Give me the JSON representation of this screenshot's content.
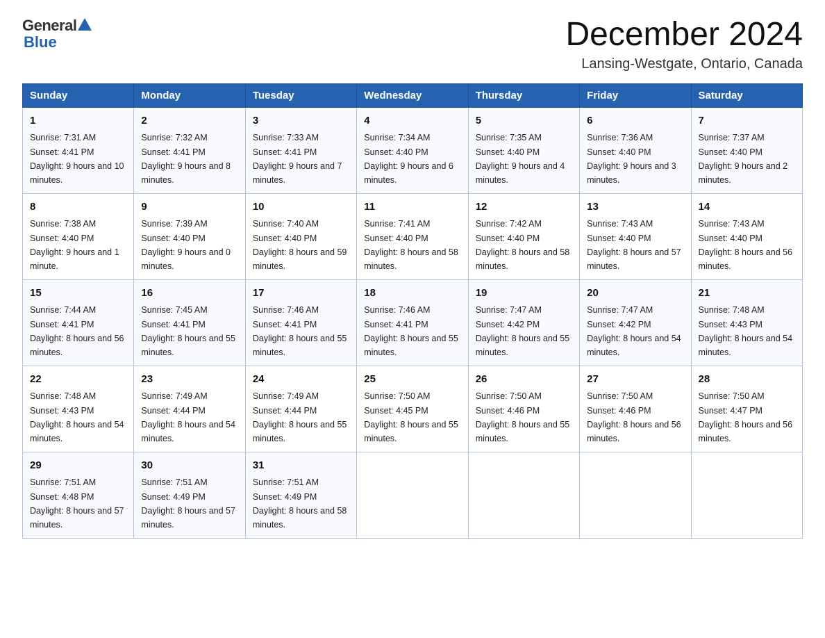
{
  "logo": {
    "general": "General",
    "blue": "Blue"
  },
  "header": {
    "title": "December 2024",
    "location": "Lansing-Westgate, Ontario, Canada"
  },
  "days_of_week": [
    "Sunday",
    "Monday",
    "Tuesday",
    "Wednesday",
    "Thursday",
    "Friday",
    "Saturday"
  ],
  "weeks": [
    [
      {
        "day": "1",
        "sunrise": "7:31 AM",
        "sunset": "4:41 PM",
        "daylight": "9 hours and 10 minutes."
      },
      {
        "day": "2",
        "sunrise": "7:32 AM",
        "sunset": "4:41 PM",
        "daylight": "9 hours and 8 minutes."
      },
      {
        "day": "3",
        "sunrise": "7:33 AM",
        "sunset": "4:41 PM",
        "daylight": "9 hours and 7 minutes."
      },
      {
        "day": "4",
        "sunrise": "7:34 AM",
        "sunset": "4:40 PM",
        "daylight": "9 hours and 6 minutes."
      },
      {
        "day": "5",
        "sunrise": "7:35 AM",
        "sunset": "4:40 PM",
        "daylight": "9 hours and 4 minutes."
      },
      {
        "day": "6",
        "sunrise": "7:36 AM",
        "sunset": "4:40 PM",
        "daylight": "9 hours and 3 minutes."
      },
      {
        "day": "7",
        "sunrise": "7:37 AM",
        "sunset": "4:40 PM",
        "daylight": "9 hours and 2 minutes."
      }
    ],
    [
      {
        "day": "8",
        "sunrise": "7:38 AM",
        "sunset": "4:40 PM",
        "daylight": "9 hours and 1 minute."
      },
      {
        "day": "9",
        "sunrise": "7:39 AM",
        "sunset": "4:40 PM",
        "daylight": "9 hours and 0 minutes."
      },
      {
        "day": "10",
        "sunrise": "7:40 AM",
        "sunset": "4:40 PM",
        "daylight": "8 hours and 59 minutes."
      },
      {
        "day": "11",
        "sunrise": "7:41 AM",
        "sunset": "4:40 PM",
        "daylight": "8 hours and 58 minutes."
      },
      {
        "day": "12",
        "sunrise": "7:42 AM",
        "sunset": "4:40 PM",
        "daylight": "8 hours and 58 minutes."
      },
      {
        "day": "13",
        "sunrise": "7:43 AM",
        "sunset": "4:40 PM",
        "daylight": "8 hours and 57 minutes."
      },
      {
        "day": "14",
        "sunrise": "7:43 AM",
        "sunset": "4:40 PM",
        "daylight": "8 hours and 56 minutes."
      }
    ],
    [
      {
        "day": "15",
        "sunrise": "7:44 AM",
        "sunset": "4:41 PM",
        "daylight": "8 hours and 56 minutes."
      },
      {
        "day": "16",
        "sunrise": "7:45 AM",
        "sunset": "4:41 PM",
        "daylight": "8 hours and 55 minutes."
      },
      {
        "day": "17",
        "sunrise": "7:46 AM",
        "sunset": "4:41 PM",
        "daylight": "8 hours and 55 minutes."
      },
      {
        "day": "18",
        "sunrise": "7:46 AM",
        "sunset": "4:41 PM",
        "daylight": "8 hours and 55 minutes."
      },
      {
        "day": "19",
        "sunrise": "7:47 AM",
        "sunset": "4:42 PM",
        "daylight": "8 hours and 55 minutes."
      },
      {
        "day": "20",
        "sunrise": "7:47 AM",
        "sunset": "4:42 PM",
        "daylight": "8 hours and 54 minutes."
      },
      {
        "day": "21",
        "sunrise": "7:48 AM",
        "sunset": "4:43 PM",
        "daylight": "8 hours and 54 minutes."
      }
    ],
    [
      {
        "day": "22",
        "sunrise": "7:48 AM",
        "sunset": "4:43 PM",
        "daylight": "8 hours and 54 minutes."
      },
      {
        "day": "23",
        "sunrise": "7:49 AM",
        "sunset": "4:44 PM",
        "daylight": "8 hours and 54 minutes."
      },
      {
        "day": "24",
        "sunrise": "7:49 AM",
        "sunset": "4:44 PM",
        "daylight": "8 hours and 55 minutes."
      },
      {
        "day": "25",
        "sunrise": "7:50 AM",
        "sunset": "4:45 PM",
        "daylight": "8 hours and 55 minutes."
      },
      {
        "day": "26",
        "sunrise": "7:50 AM",
        "sunset": "4:46 PM",
        "daylight": "8 hours and 55 minutes."
      },
      {
        "day": "27",
        "sunrise": "7:50 AM",
        "sunset": "4:46 PM",
        "daylight": "8 hours and 56 minutes."
      },
      {
        "day": "28",
        "sunrise": "7:50 AM",
        "sunset": "4:47 PM",
        "daylight": "8 hours and 56 minutes."
      }
    ],
    [
      {
        "day": "29",
        "sunrise": "7:51 AM",
        "sunset": "4:48 PM",
        "daylight": "8 hours and 57 minutes."
      },
      {
        "day": "30",
        "sunrise": "7:51 AM",
        "sunset": "4:49 PM",
        "daylight": "8 hours and 57 minutes."
      },
      {
        "day": "31",
        "sunrise": "7:51 AM",
        "sunset": "4:49 PM",
        "daylight": "8 hours and 58 minutes."
      },
      null,
      null,
      null,
      null
    ]
  ],
  "labels": {
    "sunrise": "Sunrise: ",
    "sunset": "Sunset: ",
    "daylight": "Daylight: "
  }
}
